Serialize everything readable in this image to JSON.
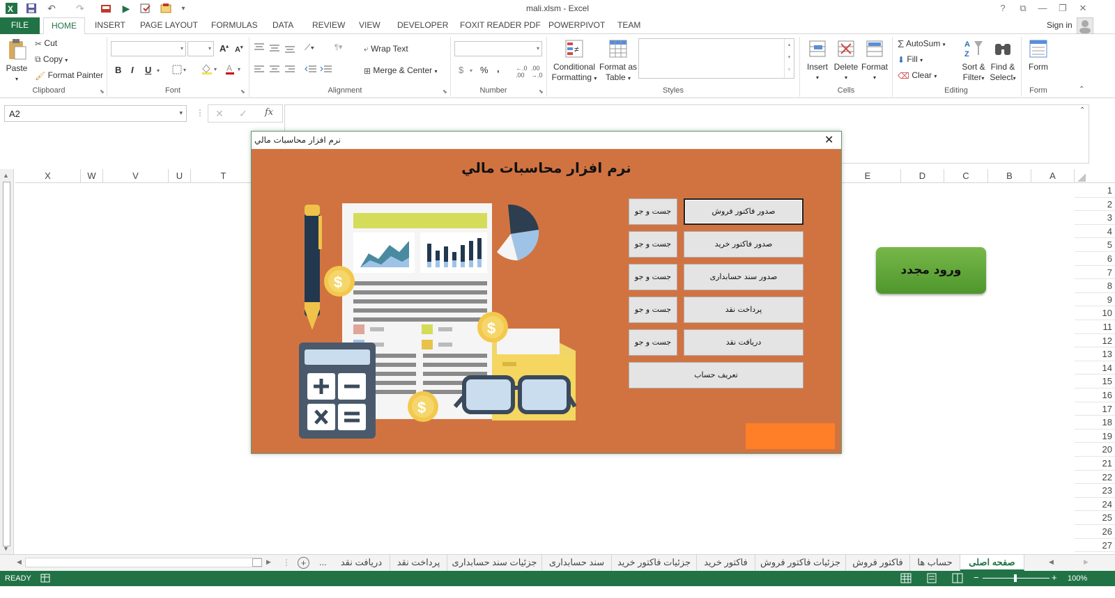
{
  "window": {
    "title": "mali.xlsm - Excel",
    "controls": [
      "?",
      "⧉",
      "—",
      "❐",
      "✕"
    ]
  },
  "ribbon_tabs": [
    "FILE",
    "HOME",
    "INSERT",
    "PAGE LAYOUT",
    "FORMULAS",
    "DATA",
    "REVIEW",
    "VIEW",
    "DEVELOPER",
    "FOXIT READER PDF",
    "POWERPIVOT",
    "TEAM"
  ],
  "active_tab": "HOME",
  "sign_in": "Sign in",
  "ribbon": {
    "clipboard": {
      "paste": "Paste",
      "cut": "Cut",
      "copy": "Copy",
      "format_painter": "Format Painter",
      "label": "Clipboard"
    },
    "font": {
      "label": "Font",
      "bold": "B",
      "italic": "I",
      "underline": "U"
    },
    "alignment": {
      "label": "Alignment",
      "wrap_text": "Wrap Text",
      "merge_center": "Merge & Center"
    },
    "number": {
      "label": "Number",
      "currency": "$",
      "percent": "%",
      "comma": ","
    },
    "styles": {
      "label": "Styles",
      "conditional_1": "Conditional",
      "conditional_2": "Formatting",
      "format_table_1": "Format as",
      "format_table_2": "Table"
    },
    "cells": {
      "label": "Cells",
      "insert": "Insert",
      "delete": "Delete",
      "format": "Format"
    },
    "editing": {
      "label": "Editing",
      "autosum": "AutoSum",
      "fill": "Fill",
      "clear": "Clear",
      "sort_1": "Sort &",
      "sort_2": "Filter",
      "find_1": "Find &",
      "find_2": "Select"
    },
    "form": {
      "label": "Form",
      "form": "Form"
    }
  },
  "formula_bar": {
    "name_box": "A2",
    "fx": "fx",
    "value": ""
  },
  "columns": [
    "X",
    "W",
    "V",
    "U",
    "T",
    "E",
    "D",
    "C",
    "B",
    "A"
  ],
  "rows": [
    "1",
    "2",
    "3",
    "4",
    "5",
    "6",
    "7",
    "8",
    "9",
    "10",
    "11",
    "12",
    "13",
    "14",
    "15",
    "16",
    "17",
    "18",
    "19",
    "20",
    "21",
    "22",
    "23",
    "24",
    "25",
    "26",
    "27"
  ],
  "relogin_button": "ورود مجدد",
  "dialog": {
    "window_title": "نرم افزار محاسبات مالي",
    "heading": "نرم افزار محاسبات مالي",
    "main_buttons": [
      "صدور فاکتور فروش",
      "صدور فاکتور خرید",
      "صدور سند حسابداری",
      "پرداخت نقد",
      "دریافت نقد"
    ],
    "search_label": "جست و جو",
    "define_account": "تعریف حساب"
  },
  "sheet_tabs": [
    "صفحه اصلی",
    "حساب ها",
    "فاکتور فروش",
    "جزئیات فاکتور فروش",
    "فاکتور خرید",
    "جزئیات فاکتور خرید",
    "سند حسابداری",
    "جزئیات سند حسابداری",
    "پرداخت نقد",
    "دریافت نقد"
  ],
  "sheet_overflow": "...",
  "status": {
    "ready": "READY",
    "zoom": "100%"
  },
  "colors": {
    "excel_green": "#217346",
    "dialog_bg": "#d17341",
    "relogin_green": "#5ea63a",
    "orange_bar": "#fe7f27"
  }
}
